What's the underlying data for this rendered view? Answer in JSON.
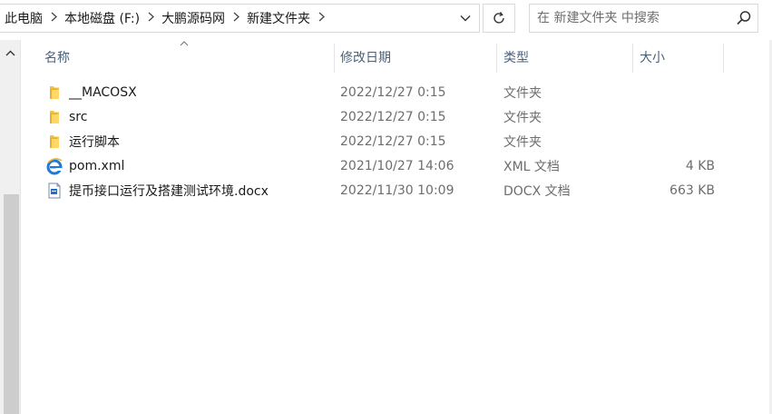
{
  "address": {
    "crumbs": [
      "此电脑",
      "本地磁盘 (F:)",
      "大鹏源码网",
      "新建文件夹"
    ]
  },
  "search": {
    "placeholder": "在 新建文件夹 中搜索"
  },
  "columns": {
    "name": "名称",
    "date": "修改日期",
    "type": "类型",
    "size": "大小"
  },
  "files": [
    {
      "name": "__MACOSX",
      "date": "2022/12/27 0:15",
      "type": "文件夹",
      "size": "",
      "icon": "folder-icon"
    },
    {
      "name": "src",
      "date": "2022/12/27 0:15",
      "type": "文件夹",
      "size": "",
      "icon": "folder-icon"
    },
    {
      "name": "运行脚本",
      "date": "2022/12/27 0:15",
      "type": "文件夹",
      "size": "",
      "icon": "folder-icon"
    },
    {
      "name": "pom.xml",
      "date": "2021/10/27 14:06",
      "type": "XML 文档",
      "size": "4 KB",
      "icon": "ie-xml-icon"
    },
    {
      "name": "提币接口运行及搭建测试环境.docx",
      "date": "2022/11/30 10:09",
      "type": "DOCX 文档",
      "size": "663 KB",
      "icon": "docx-icon"
    }
  ],
  "colors": {
    "folder": "#f5c542",
    "header_text": "#4c607a",
    "ie_blue": "#1e7ad6"
  }
}
